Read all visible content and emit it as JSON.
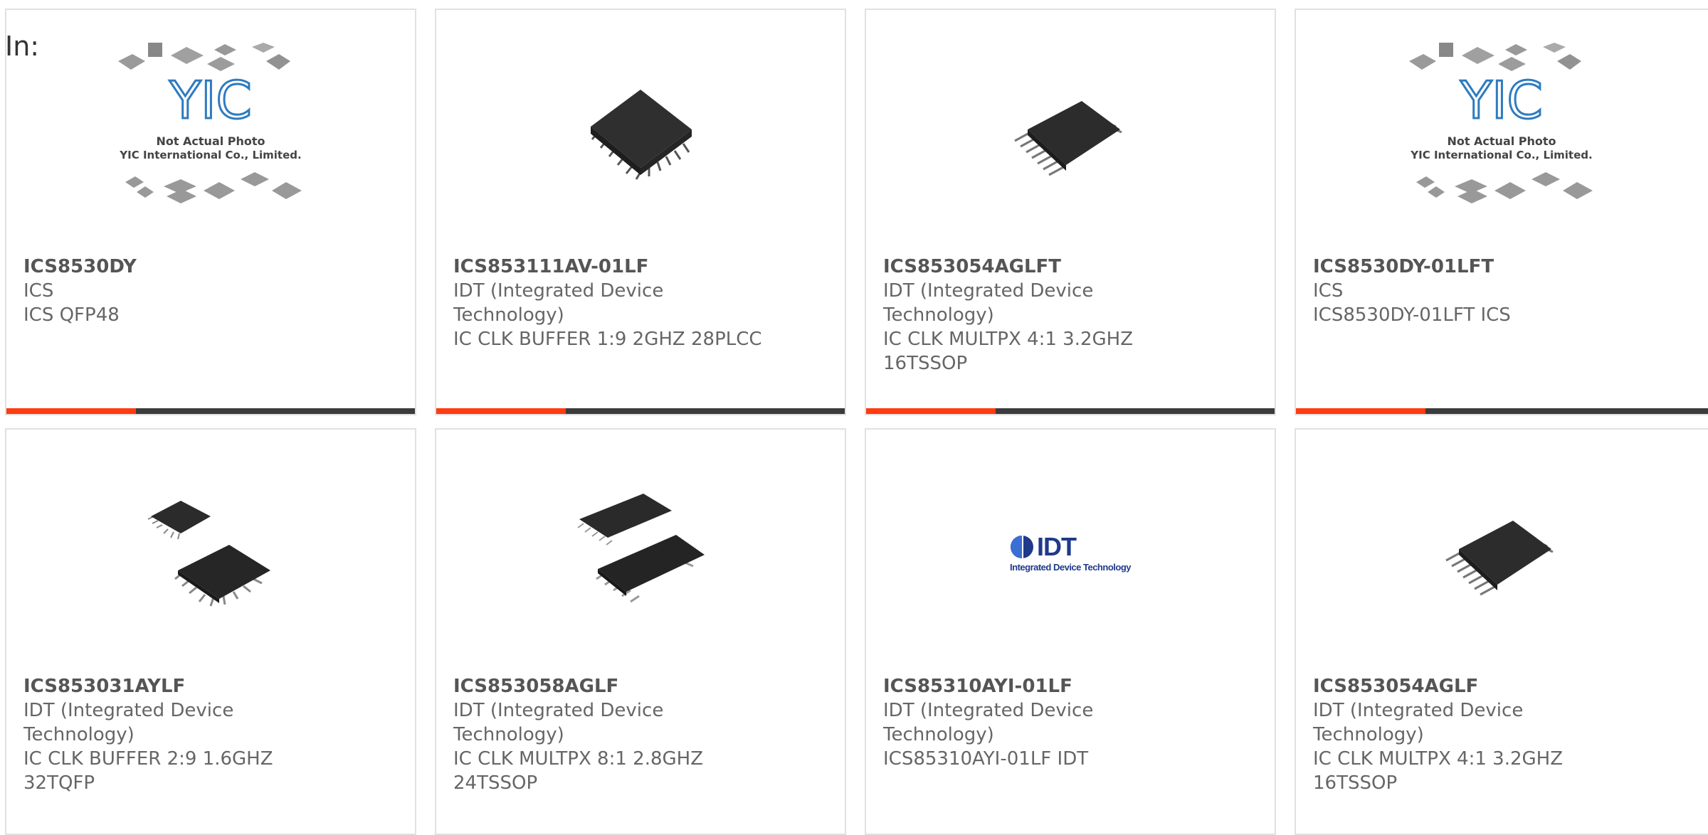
{
  "header": {
    "label": "In:"
  },
  "colors": {
    "accent": "#ff3b0f",
    "bar": "#3b3b3b",
    "border": "#e1e1e1",
    "text": "#666666"
  },
  "placeholder_image": {
    "line1": "Not Actual Photo",
    "line2": "YIC International Co., Limited.",
    "logo_text": "YIC"
  },
  "idt_logo": {
    "name": "IDT",
    "tagline": "Integrated Device Technology"
  },
  "products": [
    {
      "part": "ICS8530DY",
      "lines": [
        "ICS",
        "ICS QFP48"
      ],
      "image": "yic-placeholder"
    },
    {
      "part": "ICS853111AV-01LF",
      "lines": [
        "IDT (Integrated Device",
        "Technology)",
        "IC CLK BUFFER 1:9 2GHZ 28PLCC"
      ],
      "image": "plcc-chip"
    },
    {
      "part": "ICS853054AGLFT",
      "lines": [
        "IDT (Integrated Device",
        "Technology)",
        "IC CLK MULTPX 4:1 3.2GHZ",
        "16TSSOP"
      ],
      "image": "tssop-chip"
    },
    {
      "part": "ICS8530DY-01LFT",
      "lines": [
        "ICS",
        "ICS8530DY-01LFT ICS"
      ],
      "image": "yic-placeholder"
    },
    {
      "part": "ICS853031AYLF",
      "lines": [
        "IDT (Integrated Device",
        "Technology)",
        "IC CLK BUFFER 2:9 1.6GHZ",
        "32TQFP"
      ],
      "image": "tqfp-chips"
    },
    {
      "part": "ICS853058AGLF",
      "lines": [
        "IDT (Integrated Device",
        "Technology)",
        "IC CLK MULTPX 8:1 2.8GHZ",
        "24TSSOP"
      ],
      "image": "tssop-pair"
    },
    {
      "part": "ICS85310AYI-01LF",
      "lines": [
        "IDT (Integrated Device",
        "Technology)",
        "ICS85310AYI-01LF IDT"
      ],
      "image": "idt-logo"
    },
    {
      "part": "ICS853054AGLF",
      "lines": [
        "IDT (Integrated Device",
        "Technology)",
        "IC CLK MULTPX 4:1 3.2GHZ",
        "16TSSOP"
      ],
      "image": "tssop-chip"
    }
  ]
}
